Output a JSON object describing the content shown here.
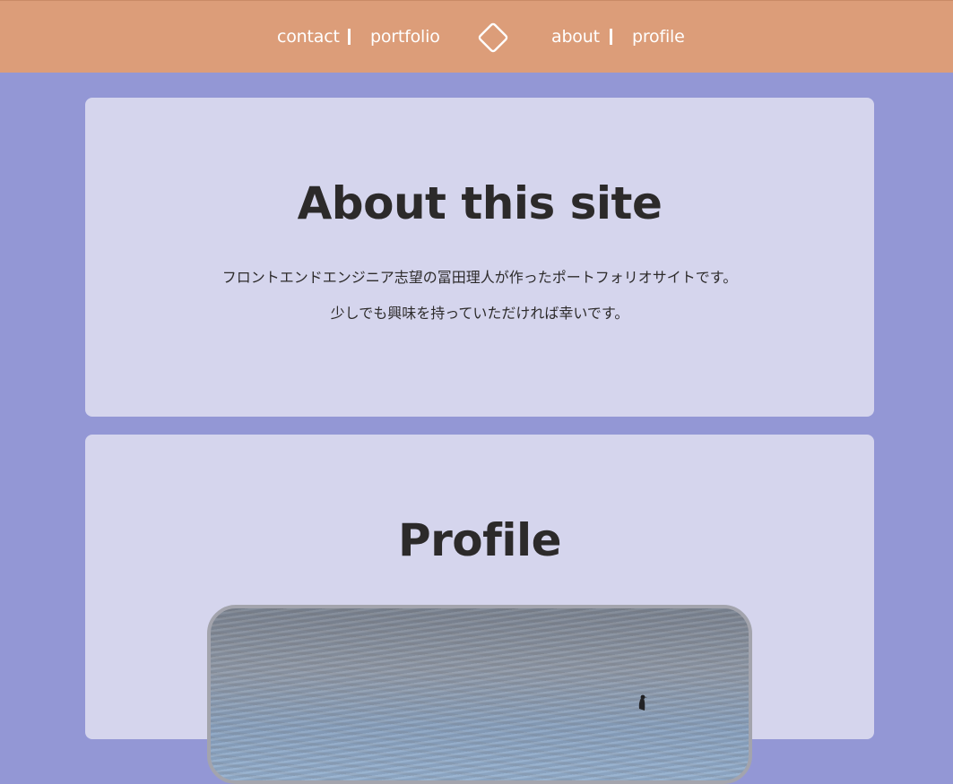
{
  "header": {
    "nav_left": [
      "contact",
      "portfolio"
    ],
    "nav_right": [
      "about",
      "profile"
    ],
    "logo_icon": "diamond-logo-icon",
    "background": "#dc9d79"
  },
  "about": {
    "title": "About this site",
    "paragraphs": [
      "フロントエンドエンジニア志望の冨田理人が作ったポートフォリオサイトです。",
      "少しでも興味を持っていただければ幸いです。"
    ]
  },
  "profile": {
    "title": "Profile",
    "photo_icon": "profile-photo"
  },
  "colors": {
    "page_background": "#9397d5",
    "card_background": "#d5d5ed",
    "text": "#2c2a2a"
  }
}
